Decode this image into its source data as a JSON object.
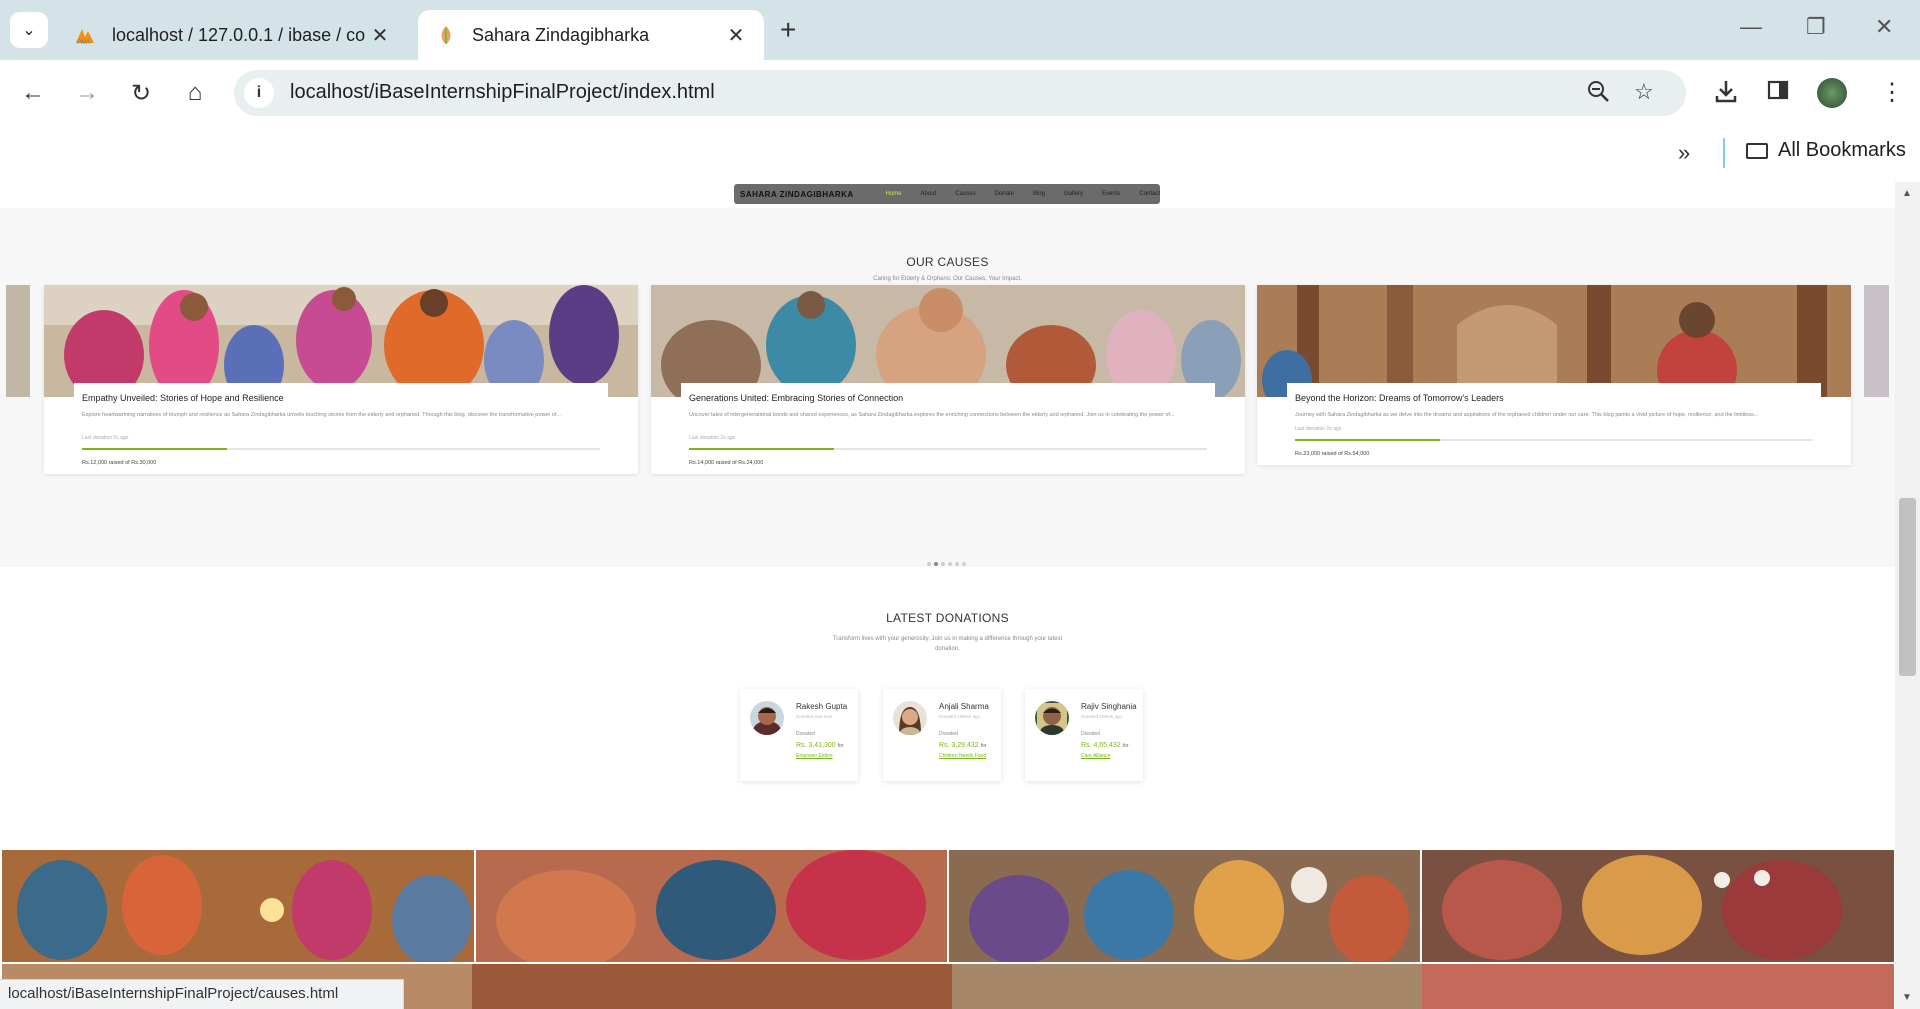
{
  "browser": {
    "tabs": [
      {
        "title": "localhost / 127.0.0.1 / ibase / co",
        "icon": "phpmyadmin-icon",
        "active": false
      },
      {
        "title": "Sahara Zindagibharka",
        "icon": "site-leaf-icon",
        "active": true
      }
    ],
    "url": "localhost/iBaseInternshipFinalProject/index.html",
    "bookmarks_label": "All Bookmarks",
    "status_url": "localhost/iBaseInternshipFinalProject/causes.html"
  },
  "site": {
    "logo": "SAHARA ZINDAGIBHARKA",
    "nav": [
      "Home",
      "About",
      "Causes",
      "Donate",
      "Blog",
      "Gallery",
      "Events",
      "Contact"
    ],
    "active_nav": "Home",
    "accent": "#7cb518"
  },
  "causes": {
    "title": "OUR CAUSES",
    "subtitle": "Caring for Elderly & Orphans: Our Causes, Your Impact.",
    "cards": [
      {
        "title": "Empathy Unveiled: Stories of Hope and Resilience",
        "desc": "Explore heartwarming narratives of triumph and resilience as Sahara Zindagibharka unveils touching stories from the elderly and orphaned. Through this blog, discover the transformative power of...",
        "last": "Last donation 5s ago",
        "progress": 0.28,
        "raised": "Rs.12,000 raised of Rs.30,000"
      },
      {
        "title": "Generations United: Embracing Stories of Connection",
        "desc": "Uncover tales of intergenerational bonds and shared experiences, as Sahara Zindagibharka explores the enriching connections between the elderly and orphaned. Join us in celebrating the power of...",
        "last": "Last donation 2s ago",
        "progress": 0.28,
        "raised": "Rs.14,000 raised of Rs.24,000"
      },
      {
        "title": "Beyond the Horizon: Dreams of Tomorrow's Leaders",
        "desc": "Journey with Sahara Zindagibharka as we delve into the dreams and aspirations of the orphaned children under our care. This blog paints a vivid picture of hope, resilience, and the limitless...",
        "last": "Last donation 2s ago",
        "progress": 0.28,
        "raised": "Rs.23,000 raised of Rs.54,000"
      }
    ],
    "dots": 6,
    "active_dot": 1
  },
  "donations": {
    "title": "LATEST DONATIONS",
    "subtitle_line1": "Transform lives with your generosity. Join us in making a difference through your latest",
    "subtitle_line2": "donation.",
    "donated_label": "Donated",
    "for_label": "for",
    "items": [
      {
        "name": "Rakesh Gupta",
        "when": "Donated Just now",
        "amount": "Rs. 3,41,300",
        "cause": "Empower Elders"
      },
      {
        "name": "Anjali Sharma",
        "when": "Donated 1Week ago",
        "amount": "Rs. 3,29,432",
        "cause": "Children Needs Food"
      },
      {
        "name": "Rajiv Singhania",
        "when": "Donated 1Week ago",
        "amount": "Rs. 4,65,432",
        "cause": "Care Alliance"
      }
    ]
  }
}
